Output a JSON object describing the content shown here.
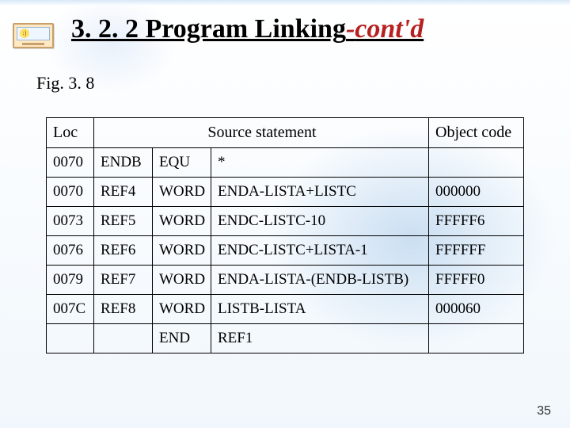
{
  "title": {
    "main": "3. 2. 2 Program Linking",
    "sep": "-",
    "cont": "cont'd"
  },
  "figure_label": "Fig. 3. 8",
  "headers": {
    "loc": "Loc",
    "source": "Source statement",
    "object": "Object code"
  },
  "rows": [
    {
      "loc": "0070",
      "label": "ENDB",
      "op": "EQU",
      "operand": "*",
      "obj": ""
    },
    {
      "loc": "0070",
      "label": "REF4",
      "op": "WORD",
      "operand": "ENDA-LISTA+LISTC",
      "obj": "000000"
    },
    {
      "loc": "0073",
      "label": "REF5",
      "op": "WORD",
      "operand": "ENDC-LISTC-10",
      "obj": "FFFFF6"
    },
    {
      "loc": "0076",
      "label": "REF6",
      "op": "WORD",
      "operand": "ENDC-LISTC+LISTA-1",
      "obj": "FFFFFF"
    },
    {
      "loc": "0079",
      "label": "REF7",
      "op": "WORD",
      "operand": "ENDA-LISTA-(ENDB-LISTB)",
      "obj": "FFFFF0"
    },
    {
      "loc": "007C",
      "label": "REF8",
      "op": "WORD",
      "operand": "LISTB-LISTA",
      "obj": "000060"
    },
    {
      "loc": "",
      "label": "",
      "op": "END",
      "operand": "REF1",
      "obj": ""
    }
  ],
  "page_number": "35"
}
